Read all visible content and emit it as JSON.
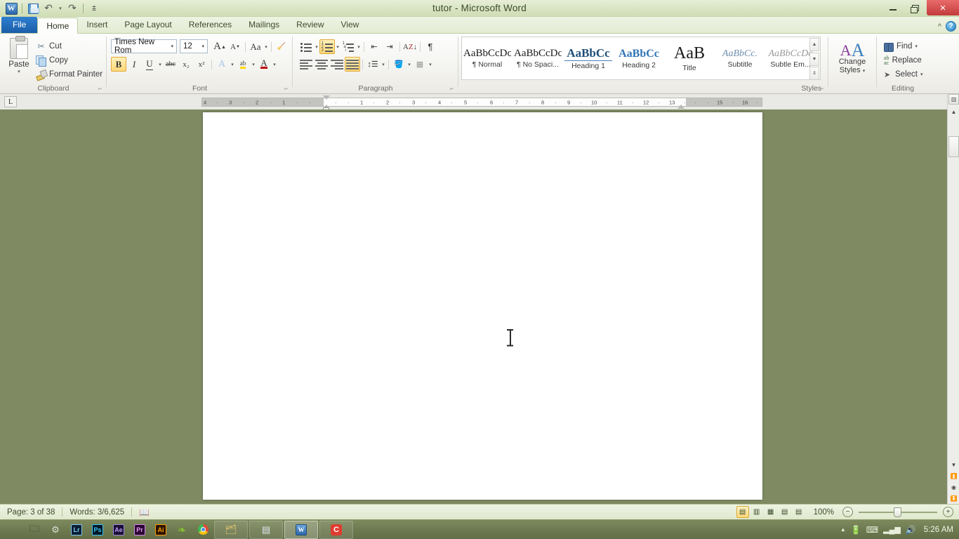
{
  "window": {
    "title": "tutor - Microsoft Word",
    "minimize_label": "minimize",
    "restore_label": "restore",
    "close_label": "×"
  },
  "quick_access": {
    "app_icon": "word-logo",
    "items": [
      {
        "name": "save-icon",
        "label": "Save"
      },
      {
        "name": "undo-icon",
        "label": "↶"
      },
      {
        "name": "redo-icon",
        "label": "↷"
      },
      {
        "name": "customize-qat-icon",
        "label": "▾"
      }
    ]
  },
  "tabs": [
    {
      "label": "File",
      "active": false,
      "file": true
    },
    {
      "label": "Home",
      "active": true
    },
    {
      "label": "Insert",
      "active": false
    },
    {
      "label": "Page Layout",
      "active": false
    },
    {
      "label": "References",
      "active": false
    },
    {
      "label": "Mailings",
      "active": false
    },
    {
      "label": "Review",
      "active": false
    },
    {
      "label": "View",
      "active": false
    }
  ],
  "tab_right": {
    "collapse_ribbon": "^",
    "help": "?"
  },
  "ribbon": {
    "clipboard": {
      "group_label": "Clipboard",
      "paste": "Paste",
      "paste_caret": "▾",
      "cut": "Cut",
      "copy": "Copy",
      "format_painter": "Format Painter",
      "dialog_launcher": "⌐"
    },
    "font": {
      "group_label": "Font",
      "font_name": "Times New Rom",
      "font_size": "12",
      "grow_font": "A",
      "shrink_font": "A",
      "change_case": "Aa",
      "clear_formatting": "A",
      "bold": "B",
      "italic": "I",
      "underline": "U",
      "strikethrough": "abc",
      "subscript": "x₂",
      "superscript": "x²",
      "text_effects": "A",
      "highlight": "ab",
      "font_color": "A",
      "caret": "▾",
      "dialog_launcher": "⌐"
    },
    "paragraph": {
      "group_label": "Paragraph",
      "bullets": "bullets",
      "numbering": "numbering",
      "multilevel": "multilevel-list",
      "decrease_indent": "decrease-indent",
      "increase_indent": "increase-indent",
      "sort": "sort",
      "show_marks": "¶",
      "align_left": "align-left",
      "align_center": "align-center",
      "align_right": "align-right",
      "justify": "justify",
      "line_spacing": "line-spacing",
      "shading": "shading",
      "borders": "borders",
      "caret": "▾",
      "dialog_launcher": "⌐"
    },
    "styles": {
      "group_label": "Styles",
      "items": [
        {
          "preview": "AaBbCcDc",
          "name": "¶ Normal"
        },
        {
          "preview": "AaBbCcDc",
          "name": "¶ No Spaci..."
        },
        {
          "preview": "AaBbCс",
          "name": "Heading 1"
        },
        {
          "preview": "AaBbCc",
          "name": "Heading 2"
        },
        {
          "preview": "AaB",
          "name": "Title"
        },
        {
          "preview": "AaBbCc.",
          "name": "Subtitle"
        },
        {
          "preview": "AaBbCcDc",
          "name": "Subtle Em..."
        }
      ],
      "scroll_up": "▲",
      "scroll_down": "▼",
      "more": "▾",
      "dialog_launcher": "⌐"
    },
    "editing": {
      "group_label": "Editing",
      "change_styles": "Change",
      "change_styles_2": "Styles",
      "change_styles_caret": "▾",
      "find": "Find",
      "find_caret": "▾",
      "replace": "Replace",
      "select": "Select",
      "select_caret": "▾"
    }
  },
  "ruler": {
    "tab_selector": "L",
    "left_ticks": [
      "4",
      "3",
      "2",
      "1"
    ],
    "right_ticks": [
      "1",
      "2",
      "3",
      "4",
      "5",
      "6",
      "7",
      "8",
      "9",
      "10",
      "11",
      "12",
      "13",
      "15",
      "16"
    ]
  },
  "document": {
    "page_background": "#ffffff",
    "workspace_color": "#7f8a63",
    "cursor": "text-ibeam"
  },
  "status_bar": {
    "page": "Page: 3 of 38",
    "words": "Words: 3/6,625",
    "proofing": "proofing-errors-icon",
    "views": [
      {
        "name": "print-layout",
        "glyph": "▤",
        "active": true
      },
      {
        "name": "full-screen-reading",
        "glyph": "▥",
        "active": false
      },
      {
        "name": "web-layout",
        "glyph": "▦",
        "active": false
      },
      {
        "name": "outline",
        "glyph": "▤",
        "active": false
      },
      {
        "name": "draft",
        "glyph": "▤",
        "active": false
      }
    ],
    "zoom": "100%",
    "zoom_out": "−",
    "zoom_in": "+"
  },
  "taskbar": {
    "pinned": [
      {
        "name": "file-explorer-icon",
        "glyph": "📁",
        "color": "#e7b94e"
      },
      {
        "name": "settings-icon",
        "glyph": "⚙",
        "color": "#cfcfcf"
      },
      {
        "name": "lightroom-icon",
        "glyph": "Lr",
        "color": "#2b4a6f"
      },
      {
        "name": "photoshop-icon",
        "glyph": "Ps",
        "color": "#0b2e44"
      },
      {
        "name": "after-effects-icon",
        "glyph": "Ae",
        "color": "#2a1a4a"
      },
      {
        "name": "premiere-icon",
        "glyph": "Pr",
        "color": "#3a1a4a"
      },
      {
        "name": "illustrator-icon",
        "glyph": "Ai",
        "color": "#3a2008"
      },
      {
        "name": "leaf-app-icon",
        "glyph": "❧",
        "color": "#7fc042"
      },
      {
        "name": "chrome-icon",
        "glyph": "◉",
        "color": "#dd4b39"
      }
    ],
    "running": [
      {
        "name": "folder-window",
        "glyph": "🗂",
        "active": false
      },
      {
        "name": "notepad-window",
        "glyph": "▤",
        "active": false
      },
      {
        "name": "word-window",
        "glyph": "W",
        "active": true
      },
      {
        "name": "app-c-window",
        "glyph": "C",
        "active": false
      }
    ],
    "tray": {
      "show_hidden": "▲",
      "battery": "battery-icon",
      "keyboard": "keyboard-icon",
      "network": "network-icon",
      "volume": "volume-icon",
      "time": "5:26 AM"
    }
  }
}
